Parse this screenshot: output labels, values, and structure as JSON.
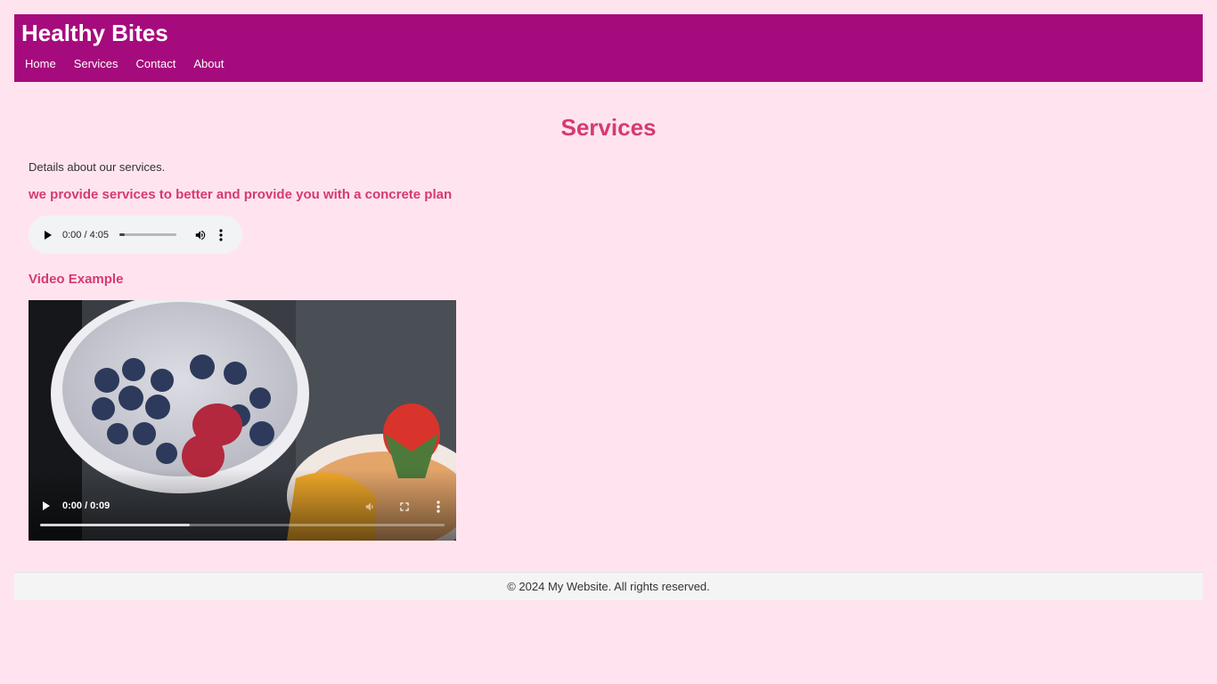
{
  "header": {
    "site_title": "Healthy Bites",
    "nav": [
      "Home",
      "Services",
      "Contact",
      "About"
    ],
    "background": "#a50b7c"
  },
  "main": {
    "page_title": "Services",
    "intro": "Details about our services.",
    "subheading": "we provide services to better and provide you with a concrete plan",
    "audio": {
      "time": "0:00 / 4:05",
      "progress": 0.1
    },
    "video_heading": "Video Example",
    "video": {
      "time": "0:00 / 0:09",
      "buffered": 0.37
    }
  },
  "footer": {
    "text": "© 2024 My Website. All rights reserved."
  },
  "colors": {
    "page_bg": "#ffe4ef",
    "accent": "#d63a6f",
    "header": "#a50b7c"
  },
  "icons": [
    "play-icon",
    "volume-icon",
    "more-vert-icon",
    "fullscreen-icon"
  ]
}
